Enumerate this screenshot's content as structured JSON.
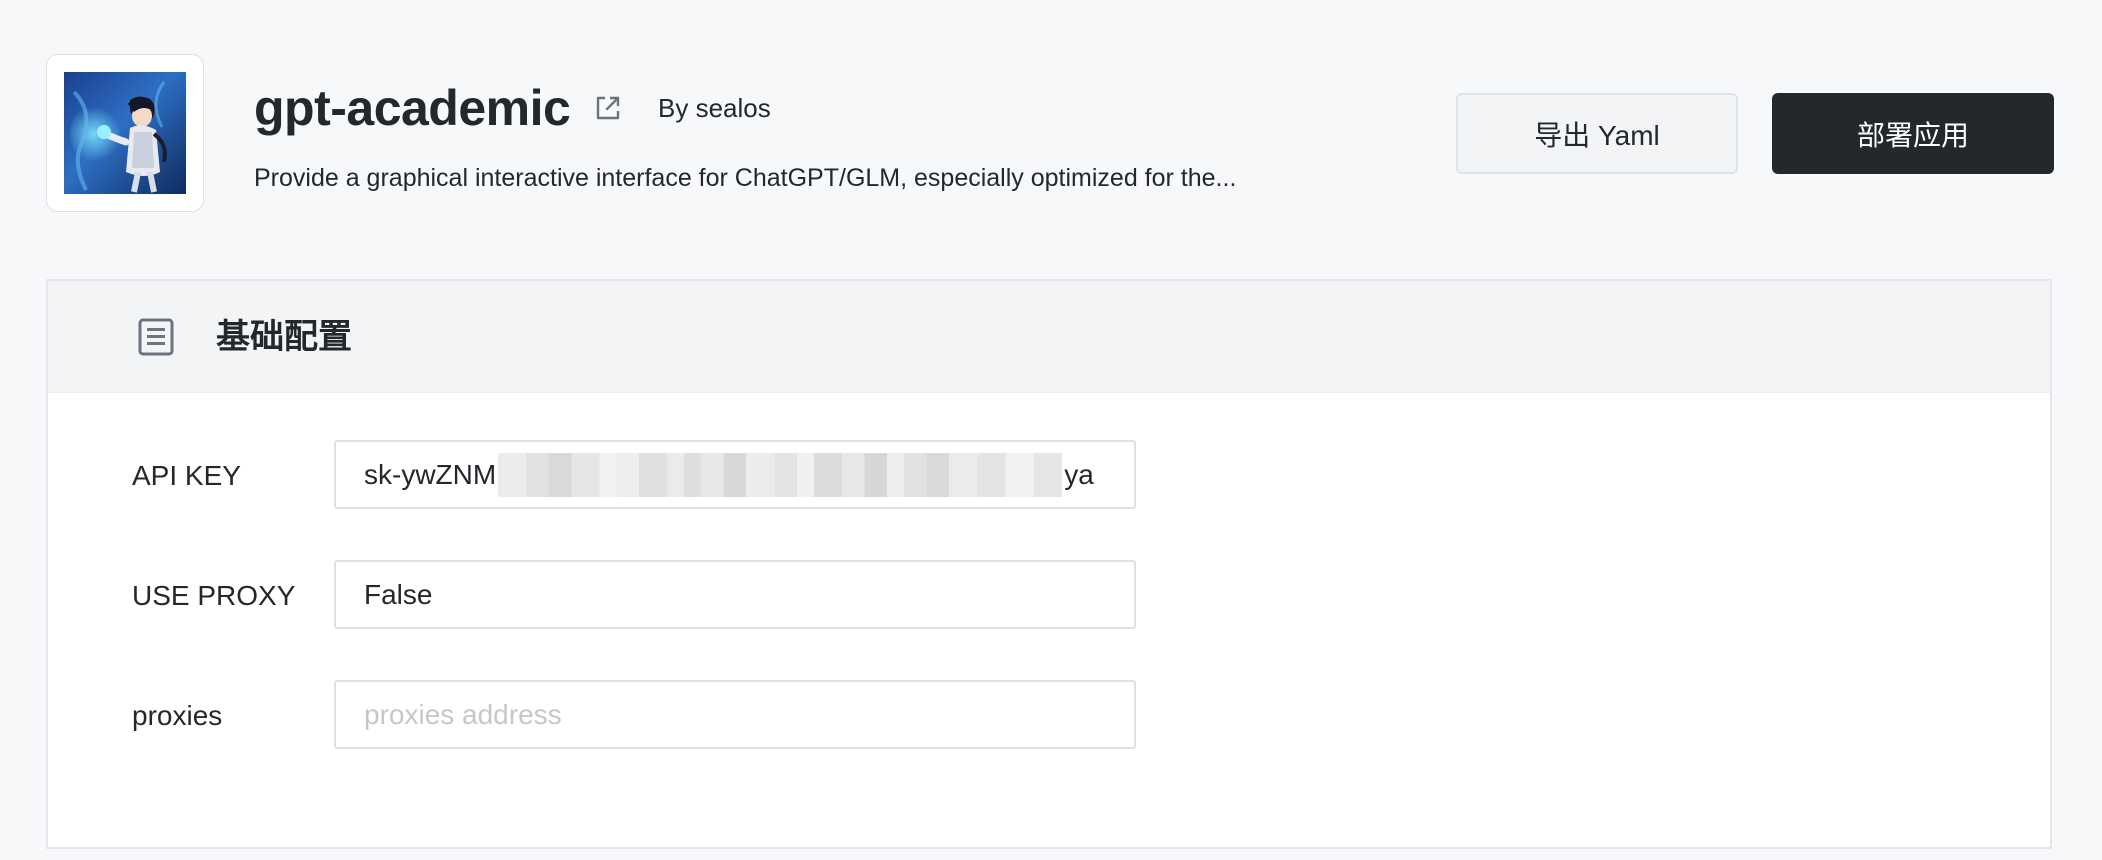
{
  "app": {
    "title": "gpt-academic",
    "author": "By sealos",
    "description": "Provide a graphical interactive interface for ChatGPT/GLM, especially optimized for the...",
    "logo_icon": "app-avatar-anime-character",
    "external_link_icon": "external-link-icon"
  },
  "actions": {
    "export_label": "导出 Yaml",
    "deploy_label": "部署应用"
  },
  "config": {
    "section_title": "基础配置",
    "section_icon": "document-list-icon",
    "fields": [
      {
        "label": "API KEY",
        "value_prefix": "sk-ywZNM",
        "value_suffix": "ya",
        "value_redacted": true
      },
      {
        "label": "USE PROXY",
        "value": "False"
      },
      {
        "label": "proxies",
        "value": "",
        "placeholder": "proxies address"
      }
    ]
  },
  "colors": {
    "page_bg": "#f7f8fa",
    "primary_button": "#24282c",
    "secondary_button": "#f3f4f6",
    "card_header_bg": "#f3f4f6",
    "border": "#dee0e2"
  }
}
